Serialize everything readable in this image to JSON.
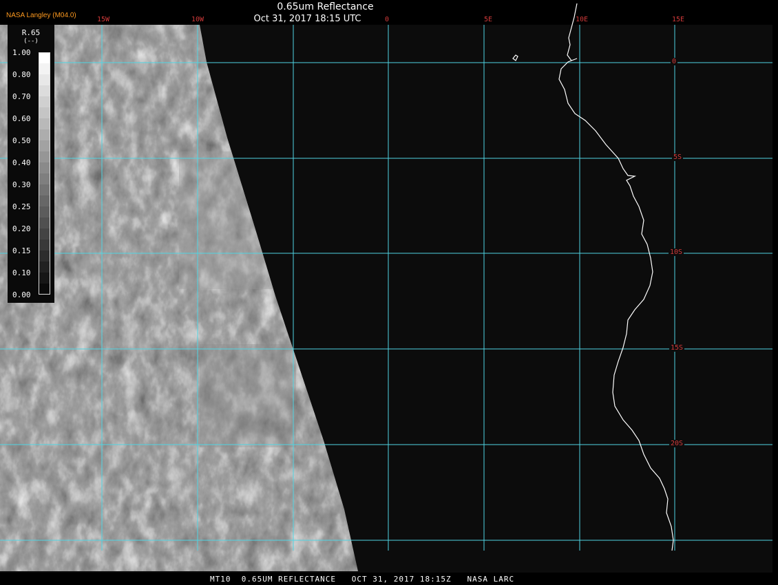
{
  "header": {
    "provider": "NASA Langley (M04.0)",
    "title": "0.65um Reflectance",
    "subtitle": "Oct 31, 2017 18:15 UTC"
  },
  "footer": {
    "text": "MT10  0.65UM REFLECTANCE   OCT 31, 2017 18:15Z   NASA LARC"
  },
  "longitude_labels": [
    "15W",
    "10W",
    "0",
    "5E",
    "10E",
    "15E"
  ],
  "latitude_labels": [
    "0",
    "5S",
    "10S",
    "15S",
    "20S"
  ],
  "legend": {
    "name": "R.65",
    "unit": "(--)",
    "ticks": [
      "1.00",
      "0.80",
      "0.70",
      "0.60",
      "0.50",
      "0.40",
      "0.30",
      "0.25",
      "0.20",
      "0.15",
      "0.10",
      "0.00"
    ]
  },
  "colors": {
    "grid": "#4fd5e3",
    "coastline": "#ffffff",
    "label_red": "#d23a3a",
    "provider_orange": "#ff9a1f",
    "background": "#0c0c0c"
  }
}
